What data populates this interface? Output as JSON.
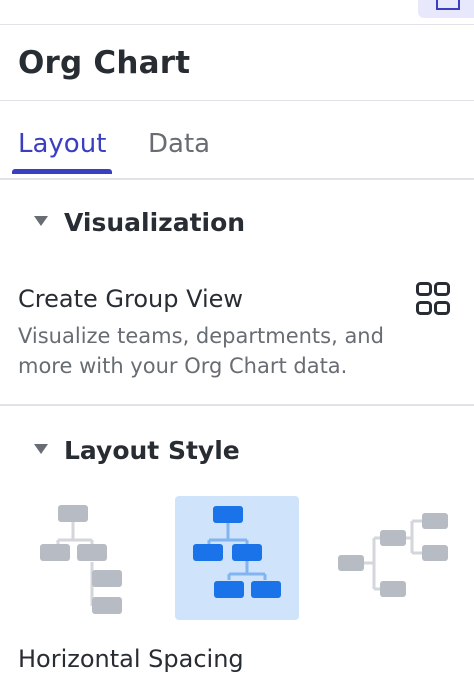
{
  "panel": {
    "title": "Org Chart"
  },
  "tabs": [
    {
      "label": "Layout",
      "active": true
    },
    {
      "label": "Data",
      "active": false
    }
  ],
  "visualization": {
    "header": "Visualization",
    "create_group_view": {
      "title": "Create Group View",
      "description": "Visualize teams, departments, and more with your Org Chart data.",
      "icon": "grid-icon"
    }
  },
  "layout_style": {
    "header": "Layout Style",
    "options": [
      {
        "name": "vertical-tree-layout",
        "selected": false
      },
      {
        "name": "top-down-tree-layout",
        "selected": true
      },
      {
        "name": "horizontal-tree-layout",
        "selected": false
      }
    ]
  },
  "horizontal_spacing": {
    "label": "Horizontal Spacing"
  },
  "colors": {
    "accent": "#3a3fc1",
    "selected_bg": "#cfe3fb",
    "node_blue": "#1a73e8",
    "node_gray": "#b7bcc4"
  }
}
